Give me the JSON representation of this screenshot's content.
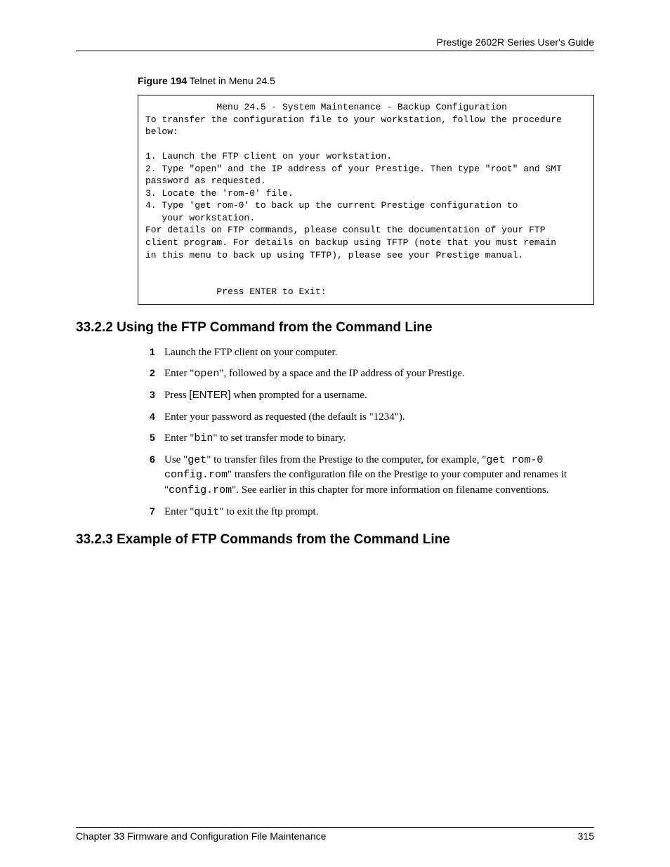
{
  "header": {
    "guide_title": "Prestige 2602R Series User's Guide"
  },
  "figure": {
    "label_bold": "Figure 194",
    "label_rest": "   Telnet in Menu 24.5",
    "telnet_content": "             Menu 24.5 - System Maintenance - Backup Configuration\nTo transfer the configuration file to your workstation, follow the procedure\nbelow:\n\n1. Launch the FTP client on your workstation.\n2. Type \"open\" and the IP address of your Prestige. Then type \"root\" and SMT\npassword as requested.\n3. Locate the 'rom-0' file.\n4. Type 'get rom-0' to back up the current Prestige configuration to\n   your workstation.\nFor details on FTP commands, please consult the documentation of your FTP\nclient program. For details on backup using TFTP (note that you must remain\nin this menu to back up using TFTP), please see your Prestige manual.\n\n\n             Press ENTER to Exit:"
  },
  "section1": {
    "heading": "33.2.2  Using the FTP Command from the Command Line",
    "items": [
      {
        "num": "1",
        "parts": [
          {
            "t": "Launch the FTP client on your computer.",
            "c": ""
          }
        ]
      },
      {
        "num": "2",
        "parts": [
          {
            "t": "Enter \"",
            "c": ""
          },
          {
            "t": "open",
            "c": "mono"
          },
          {
            "t": "\", followed by a space and the IP address of your Prestige.",
            "c": ""
          }
        ]
      },
      {
        "num": "3",
        "parts": [
          {
            "t": "Press ",
            "c": ""
          },
          {
            "t": "[ENTER]",
            "c": "sans"
          },
          {
            "t": " when prompted for a username.",
            "c": ""
          }
        ]
      },
      {
        "num": "4",
        "parts": [
          {
            "t": "Enter your password as requested (the default is \"1234\").",
            "c": ""
          }
        ]
      },
      {
        "num": "5",
        "parts": [
          {
            "t": "Enter \"",
            "c": ""
          },
          {
            "t": "bin",
            "c": "mono"
          },
          {
            "t": "\" to set transfer mode to binary.",
            "c": ""
          }
        ]
      },
      {
        "num": "6",
        "parts": [
          {
            "t": "Use \"",
            "c": ""
          },
          {
            "t": "get",
            "c": "mono"
          },
          {
            "t": "\" to transfer files from the Prestige to the computer, for example, \"",
            "c": ""
          },
          {
            "t": "get rom-0 config.rom",
            "c": "mono"
          },
          {
            "t": "\" transfers the configuration file on the Prestige to your computer and renames it \"",
            "c": ""
          },
          {
            "t": "config.rom",
            "c": "mono"
          },
          {
            "t": "\". See earlier in this chapter for more information on filename conventions.",
            "c": ""
          }
        ]
      },
      {
        "num": "7",
        "parts": [
          {
            "t": "Enter \"",
            "c": ""
          },
          {
            "t": "quit",
            "c": "mono"
          },
          {
            "t": "\" to exit the ftp prompt.",
            "c": ""
          }
        ]
      }
    ]
  },
  "section2": {
    "heading": "33.2.3  Example of FTP Commands from the Command Line"
  },
  "footer": {
    "left": "Chapter 33 Firmware and Configuration File Maintenance",
    "right": "315"
  }
}
